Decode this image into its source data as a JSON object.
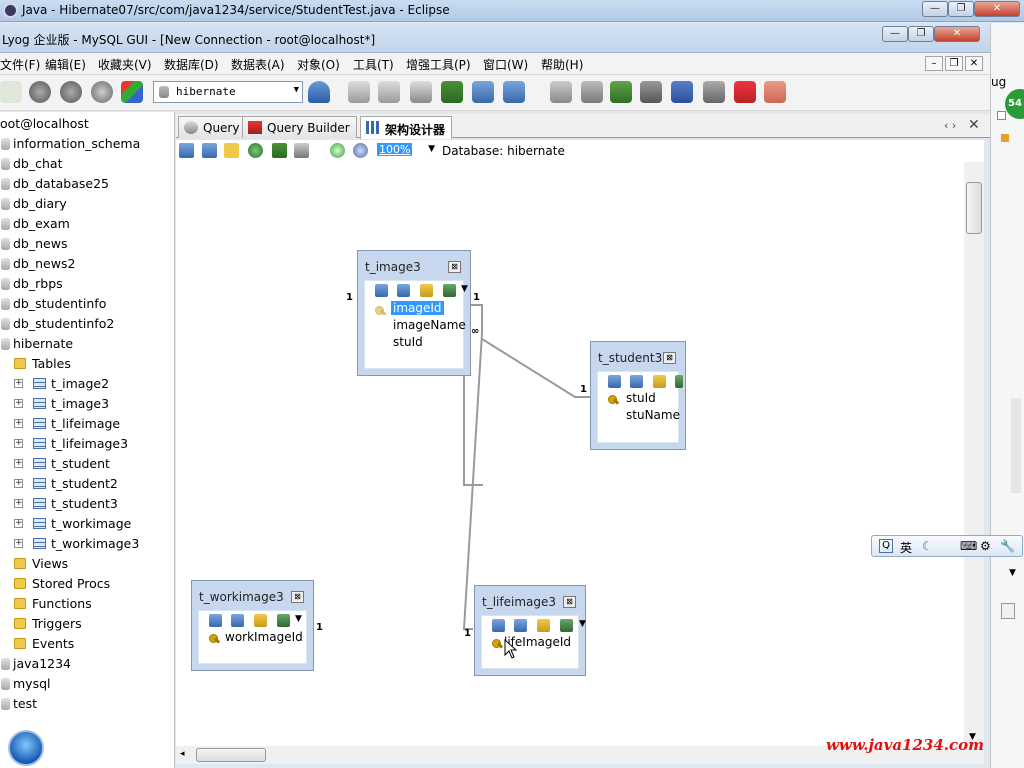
{
  "eclipse": {
    "title": "Java - Hibernate07/src/com/java1234/service/StudentTest.java - Eclipse"
  },
  "sqlyog": {
    "title": "Lyog 企业版 - MySQL GUI - [New Connection - root@localhost*]",
    "menu": [
      "文件(F)",
      "编辑(E)",
      "收藏夹(V)",
      "数据库(D)",
      "数据表(A)",
      "对象(O)",
      "工具(T)",
      "增强工具(P)",
      "窗口(W)",
      "帮助(H)"
    ],
    "database_selector": "hibernate"
  },
  "browser": {
    "root": "oot@localhost",
    "databases": [
      "information_schema",
      "db_chat",
      "db_database25",
      "db_diary",
      "db_exam",
      "db_news",
      "db_news2",
      "db_rbps",
      "db_studentinfo",
      "db_studentinfo2",
      "hibernate"
    ],
    "hibernate_children": {
      "tables_label": "Tables",
      "tables": [
        "t_image2",
        "t_image3",
        "t_lifeimage",
        "t_lifeimage3",
        "t_student",
        "t_student2",
        "t_student3",
        "t_workimage",
        "t_workimage3"
      ],
      "folders": [
        "Views",
        "Stored Procs",
        "Functions",
        "Triggers",
        "Events"
      ]
    },
    "other_databases": [
      "java1234",
      "mysql",
      "test"
    ]
  },
  "tabs": [
    {
      "label": "Query"
    },
    {
      "label": "Query Builder"
    },
    {
      "label": "架构设计器"
    }
  ],
  "designer": {
    "zoom": "100%",
    "database_label": "Database: hibernate"
  },
  "entities": {
    "t_image3": {
      "title": "t_image3",
      "columns": [
        "imageId",
        "imageName",
        "stuId"
      ]
    },
    "t_student3": {
      "title": "t_student3",
      "columns": [
        "stuId",
        "stuName"
      ]
    },
    "t_workimage3": {
      "title": "t_workimage3",
      "columns": [
        "workImageId"
      ]
    },
    "t_lifeimage3": {
      "title": "t_lifeimage3",
      "columns": [
        "lifeImageId"
      ]
    }
  },
  "cardinality": {
    "one": "1"
  },
  "right_strip": {
    "label": "ug",
    "badge": "54"
  },
  "ime": {
    "lang": "英"
  },
  "watermark": "www.java1234.com"
}
